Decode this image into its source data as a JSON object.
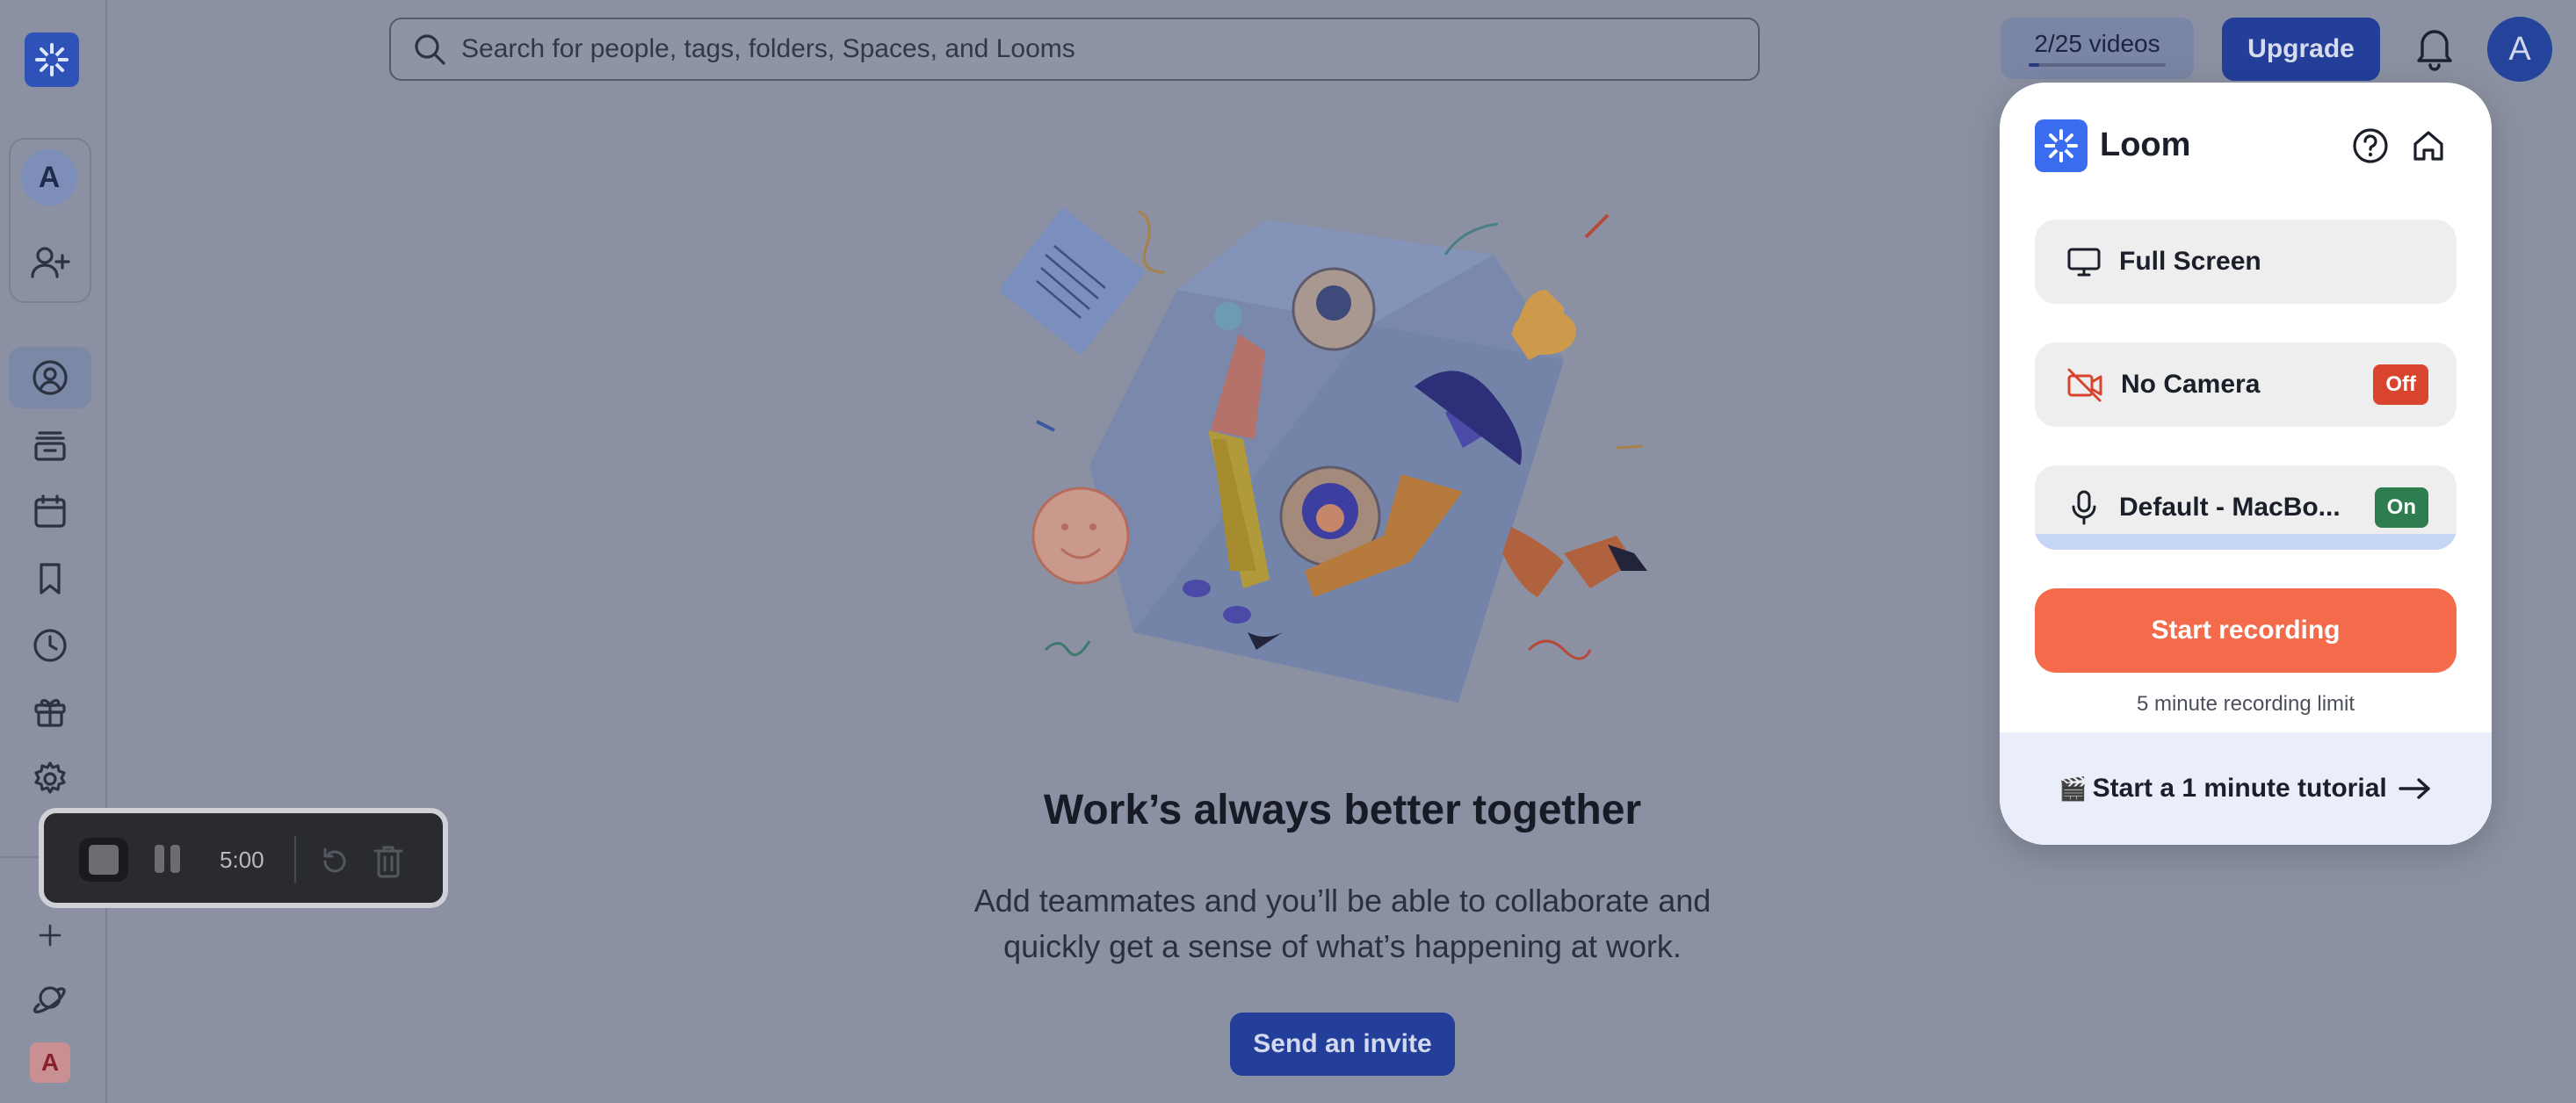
{
  "search": {
    "placeholder": "Search for people, tags, folders, Spaces, and Looms"
  },
  "header": {
    "videos_count": "2/25 videos",
    "videos_used_fraction": 0.08,
    "upgrade_label": "Upgrade",
    "user_initial": "A"
  },
  "sidebar": {
    "account_initial": "A",
    "workspace_initial": "A",
    "icons": [
      "add-person-icon",
      "user-circle-icon",
      "library-icon",
      "calendar-icon",
      "bookmark-icon",
      "clock-icon",
      "gift-icon",
      "settings-icon",
      "plus-icon",
      "planet-icon"
    ]
  },
  "recording_controls": {
    "time": "5:00"
  },
  "main": {
    "headline": "Work’s always better together",
    "subtext_line1": "Add teammates and you’ll be able to collaborate and",
    "subtext_line2": "quickly get a sense of what’s happening at work.",
    "invite_label": "Send an invite"
  },
  "popup": {
    "title": "Loom",
    "screen_option": "Full Screen",
    "camera_option": "No Camera",
    "camera_state": "Off",
    "mic_option": "Default - MacBo...",
    "mic_state": "On",
    "start_label": "Start recording",
    "limit_text": "5 minute recording limit",
    "tutorial_icon": "🎬",
    "tutorial_label": "Start a 1 minute tutorial"
  },
  "colors": {
    "overlay_bg": "#8b91a2",
    "brand_blue": "#233f9a",
    "loom_blue": "#3a6cf0",
    "record_orange": "#f36b4a",
    "off_red": "#d9442e",
    "on_green": "#2e7d4f"
  }
}
